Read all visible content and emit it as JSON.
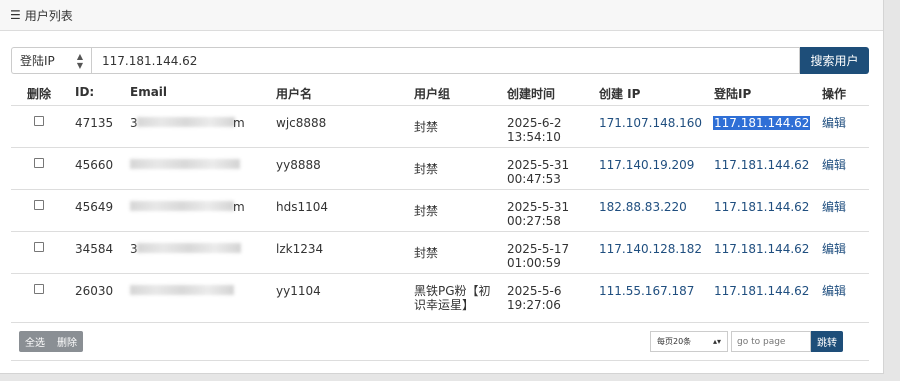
{
  "panel": {
    "title": "用户列表",
    "title_icon": "list-icon"
  },
  "search": {
    "field_select": "登陆IP",
    "query": "117.181.144.62",
    "button": "搜索用户"
  },
  "table": {
    "headers": {
      "delete": "删除",
      "id": "ID:",
      "email": "Email",
      "username": "用户名",
      "group": "用户组",
      "created": "创建时间",
      "create_ip": "创建 IP",
      "login_ip": "登陆IP",
      "action": "操作"
    },
    "rows": [
      {
        "id": "47135",
        "email_start": "3",
        "email_end": "m",
        "username": "wjc8888",
        "group": "封禁",
        "group2": "",
        "created_date": "2025-6-2",
        "created_time": "13:54:10",
        "create_ip": "171.107.148.160",
        "login_ip": "117.181.144.62",
        "action": "编辑"
      },
      {
        "id": "45660",
        "email_start": "",
        "email_end": "",
        "username": "yy8888",
        "group": "封禁",
        "group2": "",
        "created_date": "2025-5-31",
        "created_time": "00:47:53",
        "create_ip": "117.140.19.209",
        "login_ip": "117.181.144.62",
        "action": "编辑"
      },
      {
        "id": "45649",
        "email_start": "",
        "email_end": "m",
        "username": "hds1104",
        "group": "封禁",
        "group2": "",
        "created_date": "2025-5-31",
        "created_time": "00:27:58",
        "create_ip": "182.88.83.220",
        "login_ip": "117.181.144.62",
        "action": "编辑"
      },
      {
        "id": "34584",
        "email_start": "3",
        "email_end": "",
        "username": "lzk1234",
        "group": "封禁",
        "group2": "",
        "created_date": "2025-5-17",
        "created_time": "01:00:59",
        "create_ip": "117.140.128.182",
        "login_ip": "117.181.144.62",
        "action": "编辑"
      },
      {
        "id": "26030",
        "email_start": "",
        "email_end": "",
        "username": "yy1104",
        "group": "黑铁PG粉【初",
        "group2": "识幸运星】",
        "created_date": "2025-5-6",
        "created_time": "19:27:06",
        "create_ip": "111.55.167.187",
        "login_ip": "117.181.144.62",
        "action": "编辑"
      }
    ]
  },
  "footer": {
    "select_all": "全选",
    "delete": "删除",
    "per_page": "每页20条",
    "goto_placeholder": "go to page",
    "goto_button": "跳转"
  }
}
